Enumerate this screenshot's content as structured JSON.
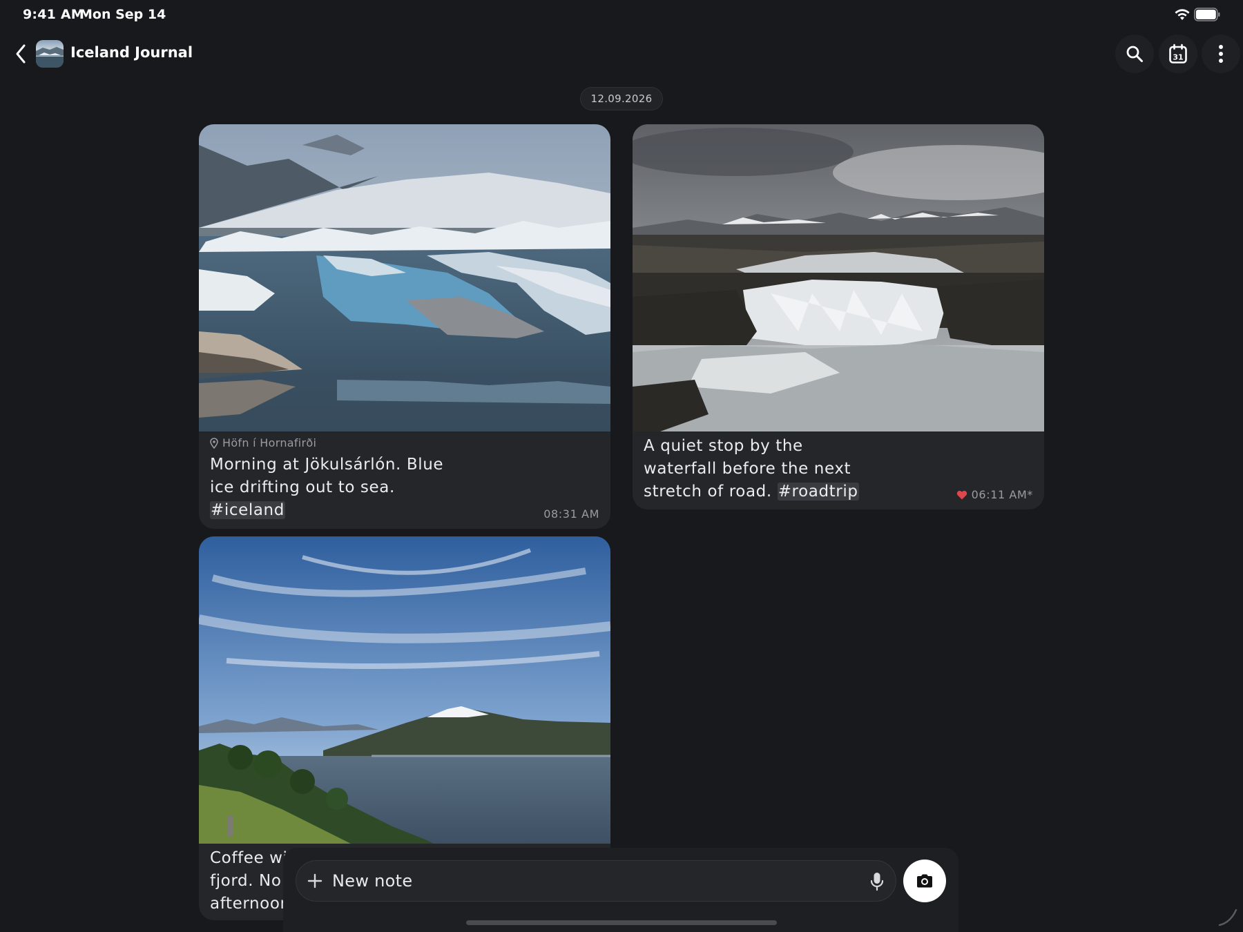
{
  "status_bar": {
    "time": "9:41 AM",
    "date": "Mon Sep 14"
  },
  "header": {
    "title": "Iceland Journal",
    "icons": [
      "chevron-left-icon",
      "search-icon",
      "calendar-icon",
      "more-vertical-icon"
    ],
    "calendar_day": "31"
  },
  "date_chip": "12.09.2026",
  "notes": [
    {
      "location": "Höfn í Hornafirði",
      "text_lines": [
        "Morning at Jökulsárlón. Blue",
        "ice drifting out to sea."
      ],
      "hashtag": "#iceland",
      "time": "08:31 AM"
    },
    {
      "text_lines": [
        "A quiet stop by the",
        "waterfall before the next"
      ],
      "text_tail": "stretch of road. ",
      "hashtag": "#roadtrip",
      "time": "06:11 AM*",
      "liked": true
    },
    {
      "text_lines": [
        "Coffee with",
        "fjord. No p",
        "afternoon"
      ]
    }
  ],
  "composer": {
    "placeholder": "New note"
  },
  "colors": {
    "background": "#18191c",
    "card": "#25262a",
    "hashtag_bg": "#3b3c41",
    "heart": "#e0464c"
  }
}
